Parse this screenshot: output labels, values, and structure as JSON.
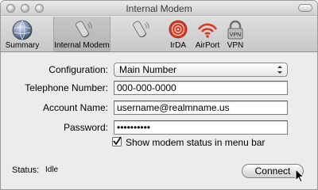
{
  "window": {
    "title": "Internal Modem"
  },
  "toolbar": {
    "items": [
      {
        "label": "Summary",
        "icon": "globe-icon"
      },
      {
        "label": "Internal Modem",
        "icon": "phone-icon",
        "selected": true
      },
      {
        "label": "",
        "icon": "phone-icon"
      },
      {
        "label": "IrDA",
        "icon": "irda-icon"
      },
      {
        "label": "AirPort",
        "icon": "airport-icon"
      },
      {
        "label": "VPN",
        "icon": "vpn-lock-icon"
      }
    ]
  },
  "form": {
    "configuration_label": "Configuration:",
    "configuration_value": "Main Number",
    "telephone_label": "Telephone Number:",
    "telephone_value": "000-000-0000",
    "account_label": "Account Name:",
    "account_value": "username@realmname.us",
    "password_label": "Password:",
    "password_value": "••••••••••",
    "show_status_label": "Show modem status in menu bar",
    "show_status_checked": true
  },
  "status": {
    "label": "Status:",
    "value": "Idle"
  },
  "actions": {
    "connect_label": "Connect"
  },
  "colors": {
    "accent_red": "#cc2a1a",
    "selected_tab": "#bdbdbd"
  }
}
